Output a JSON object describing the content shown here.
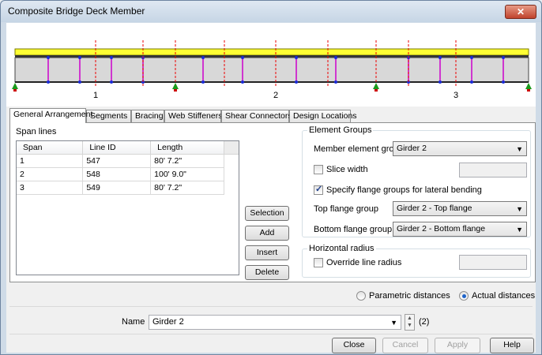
{
  "window": {
    "title": "Composite Bridge Deck Member",
    "close_label": "✕"
  },
  "diagram": {
    "span_labels": [
      "1",
      "2",
      "3"
    ]
  },
  "tabs": [
    "General Arrangement",
    "Segments",
    "Bracing",
    "Web Stiffeners",
    "Shear Connectors",
    "Design Locations"
  ],
  "span_lines": {
    "title": "Span lines",
    "columns": [
      "Span",
      "Line ID",
      "Length"
    ],
    "rows": [
      [
        "1",
        "547",
        "80' 7.2\""
      ],
      [
        "2",
        "548",
        "100' 9.0\""
      ],
      [
        "3",
        "549",
        "80' 7.2\""
      ]
    ]
  },
  "buttons": {
    "selection": "Selection",
    "add": "Add",
    "insert": "Insert",
    "delete": "Delete"
  },
  "element_groups": {
    "title": "Element Groups",
    "member_group_label": "Member element group",
    "member_group_value": "Girder 2",
    "slice_width_label": "Slice width",
    "slice_width_checked": false,
    "flange_groups_label": "Specify flange groups for lateral bending",
    "flange_groups_checked": true,
    "top_flange_label": "Top flange group",
    "top_flange_value": "Girder 2 - Top flange",
    "bottom_flange_label": "Bottom flange group",
    "bottom_flange_value": "Girder 2 - Bottom flange"
  },
  "horizontal_radius": {
    "title": "Horizontal radius",
    "override_label": "Override line radius",
    "override_checked": false
  },
  "distances": {
    "parametric_label": "Parametric distances",
    "actual_label": "Actual distances",
    "selected": "actual"
  },
  "name_row": {
    "label": "Name",
    "value": "Girder 2",
    "count": "(2)"
  },
  "footer": {
    "close": "Close",
    "cancel": "Cancel",
    "apply": "Apply",
    "help": "Help"
  }
}
